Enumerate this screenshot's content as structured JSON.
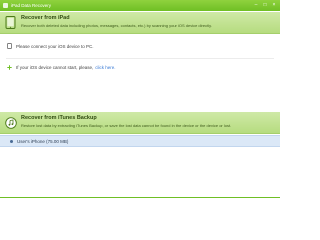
{
  "window": {
    "title": "iPad Data Recovery",
    "controls": {
      "minimize": "–",
      "maximize": "□",
      "close": "×"
    }
  },
  "sections": {
    "ipad": {
      "title": "Recover from iPad",
      "description": "Recover both deleted data including photos, messages, contacts, etc.) by scanning your iOS  device directly.",
      "icon": "ipad-icon",
      "hints": {
        "connect": "Please connect your iOS device to PC.",
        "cannot_start": "If your iOS device cannot start, please,",
        "cannot_start_link": "click here."
      }
    },
    "itunes": {
      "title": "Recover from iTunes Backup",
      "description": "Restore lost data by extracting iTunes Backup, or save the lost data cannot be found in the device or the device or lost.",
      "icon": "itunes-icon"
    }
  },
  "backups": [
    {
      "label": "User's iPhone (75.00 MB)"
    }
  ],
  "colors": {
    "brand_green": "#6fbf24",
    "header_green": "#b6dc7f",
    "selected_row": "#dbe8f7",
    "link": "#3a7bd5"
  }
}
